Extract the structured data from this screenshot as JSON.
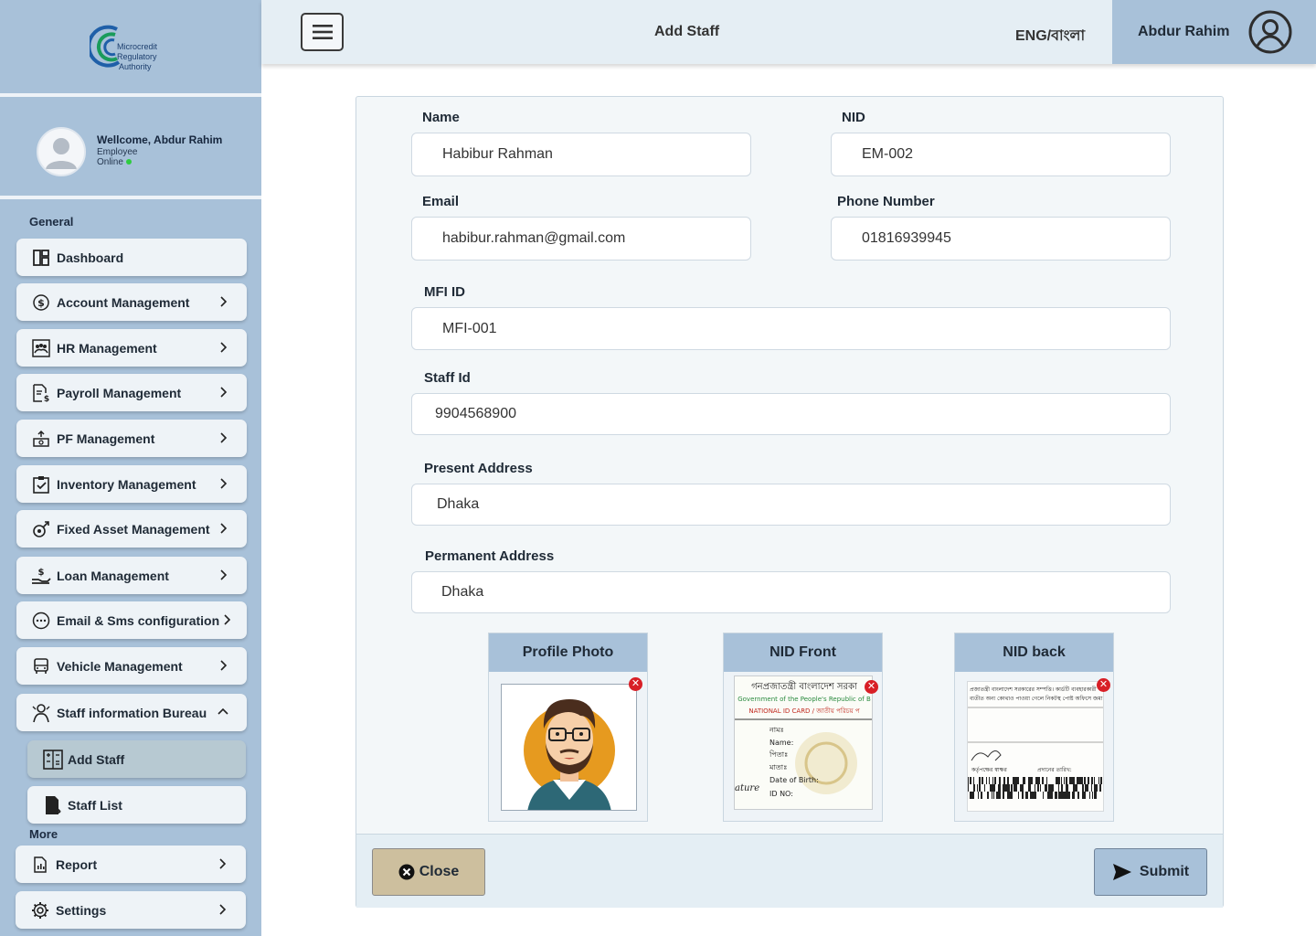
{
  "logo": {
    "line1": "Microcredit",
    "line2": "Regulatory",
    "line3": "Authority"
  },
  "profile": {
    "welcome": "Wellcome, Abdur Rahim",
    "role": "Employee",
    "status": "Online"
  },
  "sidebar": {
    "general_label": "General",
    "more_label": "More",
    "items": [
      {
        "label": "Dashboard"
      },
      {
        "label": "Account Management"
      },
      {
        "label": "HR Management"
      },
      {
        "label": "Payroll Management"
      },
      {
        "label": "PF Management"
      },
      {
        "label": "Inventory Management"
      },
      {
        "label": "Fixed Asset Management"
      },
      {
        "label": "Loan Management"
      },
      {
        "label": "Email & Sms configuration"
      },
      {
        "label": "Vehicle Management"
      },
      {
        "label": "Staff information Bureau"
      }
    ],
    "sub_items": [
      {
        "label": "Add Staff",
        "active": true
      },
      {
        "label": "Staff List",
        "active": false
      }
    ],
    "more_items": [
      {
        "label": "Report"
      },
      {
        "label": "Settings"
      }
    ]
  },
  "header": {
    "title": "Add Staff",
    "language": "ENG/বাংলা",
    "user_name": "Abdur Rahim"
  },
  "form": {
    "name": {
      "label": "Name",
      "value": "Habibur Rahman"
    },
    "nid": {
      "label": "NID",
      "value": "EM-002"
    },
    "email": {
      "label": "Email",
      "value": "habibur.rahman@gmail.com"
    },
    "phone": {
      "label": "Phone Number",
      "value": "01816939945"
    },
    "mfi_id": {
      "label": "MFI ID",
      "value": "MFI-001"
    },
    "staff_id": {
      "label": "Staff Id",
      "value": "9904568900"
    },
    "present_address": {
      "label": "Present Address",
      "value": "Dhaka"
    },
    "permanent_address": {
      "label": "Permanent Address",
      "value": "Dhaka"
    }
  },
  "uploads": {
    "profile_photo": {
      "title": "Profile Photo"
    },
    "nid_front": {
      "title": "NID Front",
      "line1": "গনপ্রজাতন্ত্রী বাংলাদেশ সরকা",
      "line2": "Government of the People's Republic of B",
      "line3": "NATIONAL ID CARD / জাতীয় পরিচয় প",
      "field1": "নামঃ",
      "field2": "Name:",
      "field3": "পিতাঃ",
      "field4": "মাতাঃ",
      "field5": "Date of Birth:",
      "field6": "ID NO:",
      "signature": "ature"
    },
    "nid_back": {
      "title": "NID back",
      "line1": "প্রজাতন্ত্রী বাংলাদেশ সরকারের সম্পত্তি। কার্ডটি ব্যবহারকারী",
      "line2": "ব্যতীত অন্য কোথাও পাওয়া গেলে নিকটস্থ পোষ্ট অফিসে জমা দেয়ার জন্য অনুরোধ ক",
      "sign_label": "কর্তৃপক্ষের স্বাক্ষর",
      "date_label": "প্রদানের তারিখ:"
    }
  },
  "buttons": {
    "close": "Close",
    "submit": "Submit"
  },
  "colors": {
    "sidebar": "#a8c1d9",
    "topbar": "#e5eef4",
    "danger": "#d81f26",
    "close_btn": "#cdbf9e"
  }
}
